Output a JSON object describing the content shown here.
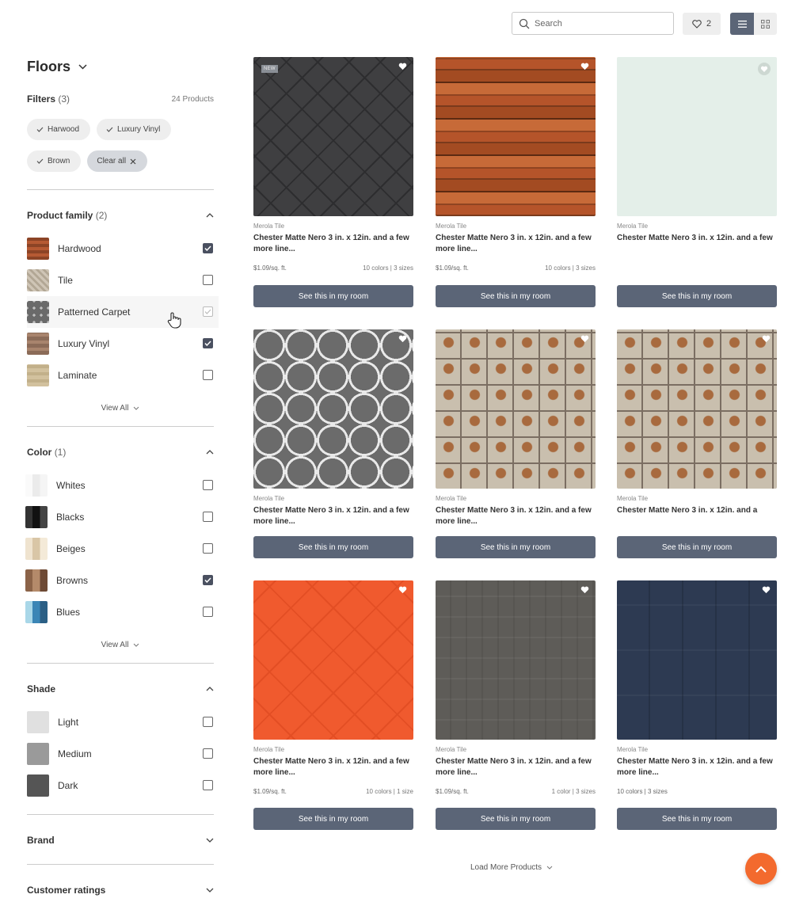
{
  "header": {
    "search_placeholder": "Search",
    "favorites_count": "2",
    "icons": {
      "search": "search-icon",
      "heart": "heart-icon",
      "list_view": "list-view-icon",
      "grid_view": "grid-view-icon"
    }
  },
  "sidebar": {
    "title": "Floors",
    "filters_label": "Filters",
    "filters_count": "(3)",
    "products_count": "24 Products",
    "chips": [
      "Harwood",
      "Luxury Vinyl",
      "Brown"
    ],
    "clear_all": "Clear all",
    "product_family": {
      "label": "Product family",
      "count": "(2)",
      "items": [
        {
          "label": "Hardwood",
          "checked": true
        },
        {
          "label": "Tile",
          "checked": false
        },
        {
          "label": "Patterned Carpet",
          "checked": false
        },
        {
          "label": "Luxury Vinyl",
          "checked": true
        },
        {
          "label": "Laminate",
          "checked": false
        }
      ],
      "view_all": "View All"
    },
    "color": {
      "label": "Color",
      "count": "(1)",
      "items": [
        {
          "label": "Whites",
          "checked": false
        },
        {
          "label": "Blacks",
          "checked": false
        },
        {
          "label": "Beiges",
          "checked": false
        },
        {
          "label": "Browns",
          "checked": true
        },
        {
          "label": "Blues",
          "checked": false
        }
      ],
      "view_all": "View All"
    },
    "shade": {
      "label": "Shade",
      "items": [
        {
          "label": "Light",
          "color": "#e0e0e0",
          "checked": false
        },
        {
          "label": "Medium",
          "color": "#9a9a9a",
          "checked": false
        },
        {
          "label": "Dark",
          "color": "#555555",
          "checked": false
        }
      ]
    },
    "brand": {
      "label": "Brand"
    },
    "ratings": {
      "label": "Customer ratings"
    }
  },
  "products": [
    {
      "brand": "Merola Tile",
      "name": "Chester Matte Nero 3 in. x 12in. and a few more line...",
      "price": "$1.09/sq. ft.",
      "variants": "10 colors  |  3 sizes",
      "cta": "See this in my room",
      "badge": "NEW"
    },
    {
      "brand": "Merola Tile",
      "name": "Chester Matte Nero 3 in. x 12in. and a few more line...",
      "price": "$1.09/sq. ft.",
      "variants": "10 colors  |  3 sizes",
      "cta": "See this in my room"
    },
    {
      "brand": "Merola Tile",
      "name": "Chester Matte Nero 3 in. x 12in. and a few",
      "price": "",
      "variants": "",
      "cta": "See this in my room"
    },
    {
      "brand": "Merola Tile",
      "name": "Chester Matte Nero 3 in. x 12in. and a few more line...",
      "price": "",
      "variants": "",
      "cta": "See this in my room"
    },
    {
      "brand": "Merola Tile",
      "name": "Chester Matte Nero 3 in. x 12in. and a few more line...",
      "price": "",
      "variants": "",
      "cta": "See this in my room"
    },
    {
      "brand": "Merola Tile",
      "name": "Chester Matte Nero 3 in. x 12in. and a",
      "price": "",
      "variants": "",
      "cta": "See this in my room"
    },
    {
      "brand": "Merola Tile",
      "name": "Chester Matte Nero 3 in. x 12in. and a few more line...",
      "price": "$1.09/sq. ft.",
      "variants": "10 colors | 1 size",
      "cta": "See this in my room"
    },
    {
      "brand": "Merola Tile",
      "name": "Chester Matte Nero 3 in. x 12in. and a few more line...",
      "price": "$1.09/sq. ft.",
      "variants": "1 color | 3 sizes",
      "cta": "See this in my room"
    },
    {
      "brand": "Merola Tile",
      "name": "Chester Matte Nero 3 in. x 12in. and a few more line...",
      "price": "10 colors  |  3 sizes",
      "variants": "",
      "cta": "See this in my room"
    }
  ],
  "load_more": "Load More Products",
  "colors": {
    "accent": "#5b6577",
    "fab": "#f36a2e"
  }
}
